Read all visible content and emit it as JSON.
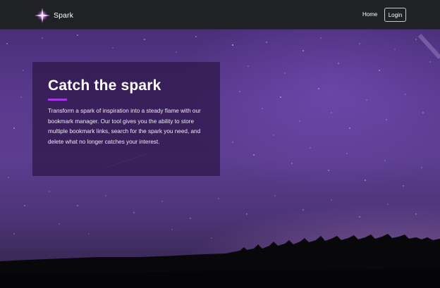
{
  "navbar": {
    "brand_name": "Spark",
    "links": {
      "home": "Home",
      "login": "Login"
    }
  },
  "hero": {
    "title": "Catch the spark",
    "description": "Transform a spark of inspiration into a steady flame with our bookmark manager. Our tool gives you the ability to store multiple bookmark links, search for the spark you need, and delete what no longer catches your interest."
  },
  "icons": {
    "brand": "sparkle-star-icon"
  },
  "colors": {
    "navbar_bg": "#202124",
    "accent": "#a634e8",
    "sky": "#5a3a8e",
    "card_bg": "#2c1646"
  }
}
